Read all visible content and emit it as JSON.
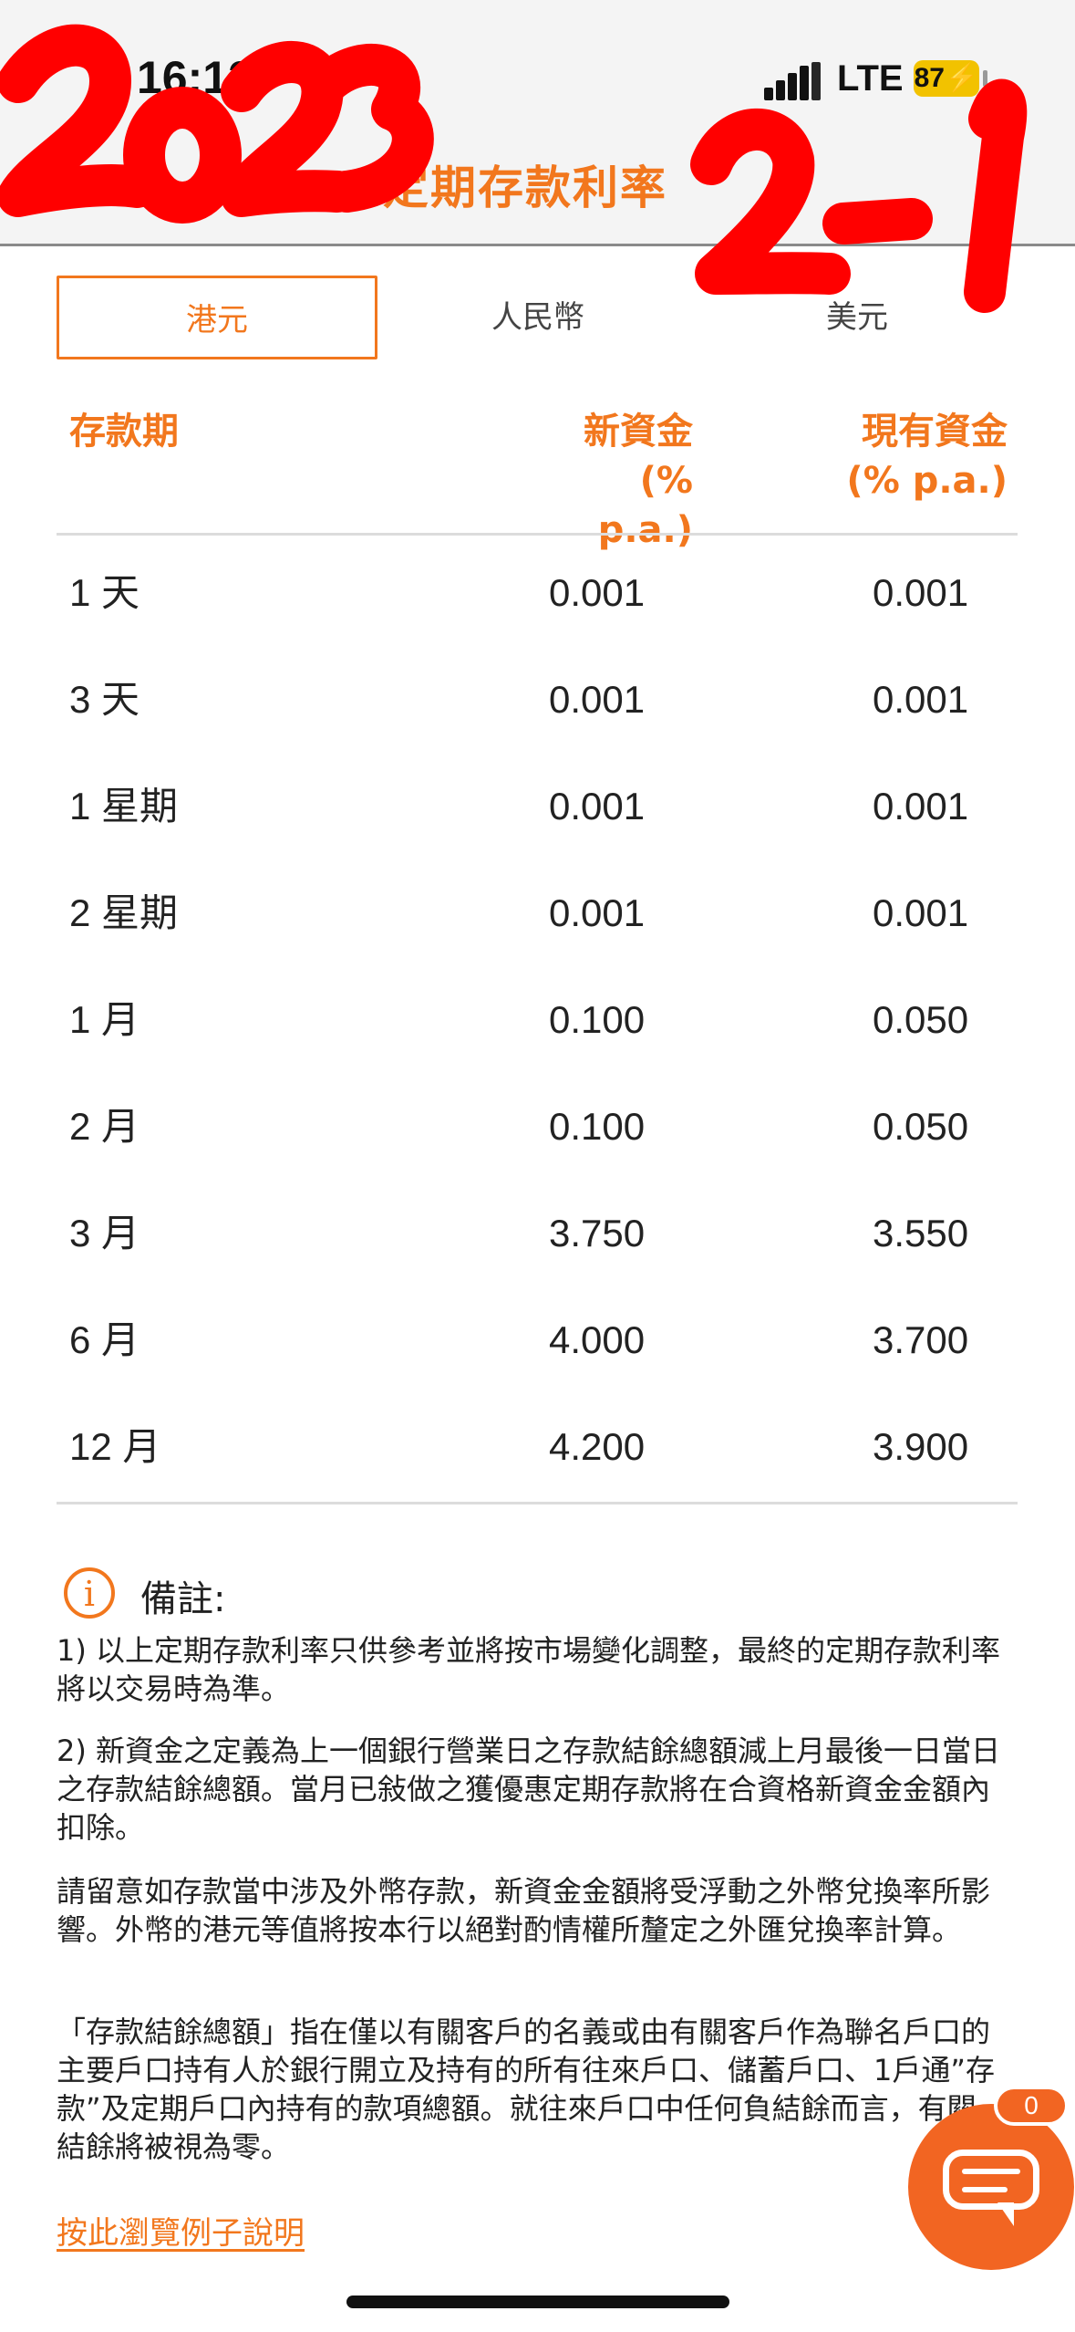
{
  "status_bar": {
    "time": "16:12",
    "network": "LTE",
    "battery": "87"
  },
  "header": {
    "title": "定期存款利率"
  },
  "annotation": {
    "year": "2023",
    "date": "2-1",
    "color": "#ff0000"
  },
  "tabs": [
    {
      "label": "港元",
      "active": true
    },
    {
      "label": "人民幣",
      "active": false
    },
    {
      "label": "美元",
      "active": false
    }
  ],
  "table": {
    "columns": {
      "term": "存款期",
      "new_funds": "新資金",
      "new_funds_unit": "(% p.a.)",
      "existing_funds": "現有資金",
      "existing_funds_unit": "(% p.a.)"
    },
    "rows": [
      {
        "term": "1 天",
        "new": "0.001",
        "existing": "0.001"
      },
      {
        "term": "3 天",
        "new": "0.001",
        "existing": "0.001"
      },
      {
        "term": "1 星期",
        "new": "0.001",
        "existing": "0.001"
      },
      {
        "term": "2 星期",
        "new": "0.001",
        "existing": "0.001"
      },
      {
        "term": "1 月",
        "new": "0.100",
        "existing": "0.050"
      },
      {
        "term": "2 月",
        "new": "0.100",
        "existing": "0.050"
      },
      {
        "term": "3 月",
        "new": "3.750",
        "existing": "3.550"
      },
      {
        "term": "6 月",
        "new": "4.000",
        "existing": "3.700"
      },
      {
        "term": "12 月",
        "new": "4.200",
        "existing": "3.900"
      }
    ]
  },
  "notes": {
    "title": "備註:",
    "items": [
      "1) 以上定期存款利率只供參考並將按市場變化調整，最終的定期存款利率將以交易時為準。",
      "2) 新資金之定義為上一個銀行營業日之存款結餘總額減上月最後一日當日之存款結餘總額。當月已敍做之獲優惠定期存款將在合資格新資金金額內扣除。",
      "請留意如存款當中涉及外幣存款，新資金金額將受浮動之外幣兌換率所影響。外幣的港元等值將按本行以絕對酌情權所釐定之外匯兌換率計算。",
      "「存款結餘總額」指在僅以有關客戶的名義或由有關客戶作為聯名戶口的主要戶口持有人於銀行開立及持有的所有往來戶口、儲蓄戶口、1戶通”存款”及定期戶口內持有的款項總額。就往來戶口中任何負結餘而言，有關結餘將被視為零。"
    ],
    "link": "按此瀏覽例子說明"
  },
  "chat": {
    "badge_count": "0"
  },
  "colors": {
    "accent": "#f2771d",
    "fab": "#f26522"
  }
}
